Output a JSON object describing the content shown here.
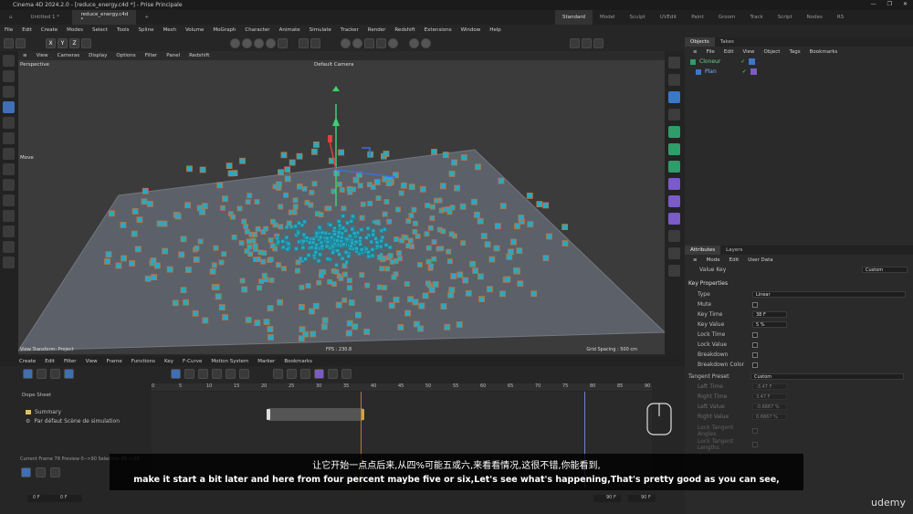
{
  "titlebar": {
    "text": "Cinema 4D 2024.2.0 - [reduce_energy.c4d *] - Prise Principale",
    "doc_tab1": "Untitled 1 *",
    "doc_tab2": "reduce_energy.c4d *",
    "plus": "+"
  },
  "layouts": [
    "Standard",
    "Model",
    "Sculpt",
    "UVEdit",
    "Paint",
    "Groom",
    "Track",
    "Script",
    "Nodes",
    "RS"
  ],
  "menus": [
    "File",
    "Edit",
    "Create",
    "Modes",
    "Select",
    "Tools",
    "Spline",
    "Mesh",
    "Volume",
    "MoGraph",
    "Character",
    "Animate",
    "Simulate",
    "Tracker",
    "Render",
    "Redshift",
    "Extensions",
    "Window",
    "Help"
  ],
  "axis_buttons": [
    "X",
    "Y",
    "Z"
  ],
  "viewport": {
    "menus": [
      "View",
      "Cameras",
      "Display",
      "Options",
      "Filter",
      "Panel",
      "Redshift"
    ],
    "name": "Perspective",
    "camera": "Default Camera",
    "move_label": "Move",
    "status_left": "View Transform: Project",
    "fps": "FPS : 230.8",
    "grid": "Grid Spacing : 500 cm"
  },
  "objects_panel": {
    "tabs": [
      "Objects",
      "Takes"
    ],
    "menus": [
      "File",
      "Edit",
      "View",
      "Object",
      "Tags",
      "Bookmarks"
    ],
    "items": [
      "Cloneur",
      "Plan"
    ]
  },
  "attributes": {
    "tabs": [
      "Attributes",
      "Layers"
    ],
    "menus": [
      "Mode",
      "Edit",
      "User Data"
    ],
    "value_key_label": "Value Key",
    "value_key_mode": "Custom",
    "section": "Key Properties",
    "rows": [
      {
        "label": "Type",
        "value": "Linear"
      },
      {
        "label": "Mute",
        "value": ""
      },
      {
        "label": "Key Time",
        "value": "38 F"
      },
      {
        "label": "Key Value",
        "value": "5 %"
      },
      {
        "label": "Lock Time",
        "value": ""
      },
      {
        "label": "Lock Value",
        "value": ""
      },
      {
        "label": "Breakdown",
        "value": ""
      },
      {
        "label": "Breakdown Color",
        "value": ""
      }
    ],
    "tangent_label": "Tangent Preset",
    "tangent_value": "Custom",
    "tangent_rows": [
      {
        "label": "Left Time",
        "value": "-3.47 F"
      },
      {
        "label": "Right Time",
        "value": "3.47 F"
      },
      {
        "label": "Left Value",
        "value": "-0.6667 %"
      },
      {
        "label": "Right Value",
        "value": "0.6667 %"
      }
    ],
    "lower_rows": [
      "Lock Tangent Angles",
      "Lock Tangent Lengths"
    ]
  },
  "timeline": {
    "menus": [
      "Create",
      "Edit",
      "Filter",
      "View",
      "Frame",
      "Functions",
      "Key",
      "F-Curve",
      "Motion System",
      "Marker",
      "Bookmarks"
    ],
    "title": "Dope Sheet",
    "tracks": [
      "Summary",
      "Par défaut Scène de simulation"
    ],
    "ruler": [
      "0",
      "5",
      "10",
      "15",
      "20",
      "25",
      "30",
      "35",
      "40",
      "45",
      "50",
      "55",
      "60",
      "65",
      "70",
      "75",
      "80",
      "85",
      "90"
    ],
    "status": "Current Frame 78  Preview 0-->90  Selection 38-->38",
    "frame_left": "0 F",
    "frame_left2": "0 F",
    "frame_end": "90 F",
    "frame_end2": "90 F"
  },
  "subtitles": {
    "zh": "让它开始一点点后来,从四%可能五或六,来看看情况,这很不错,你能看到,",
    "en": "make it start a bit later and here from four percent maybe five or six,Let's see what's happening,That's pretty good as you can see,"
  },
  "watermark": "udemy",
  "colors": {
    "accent": "#3f6fb5",
    "clone": "#2aa9c0",
    "clone_border": "#b97345",
    "keyframe": "#e0a030"
  }
}
